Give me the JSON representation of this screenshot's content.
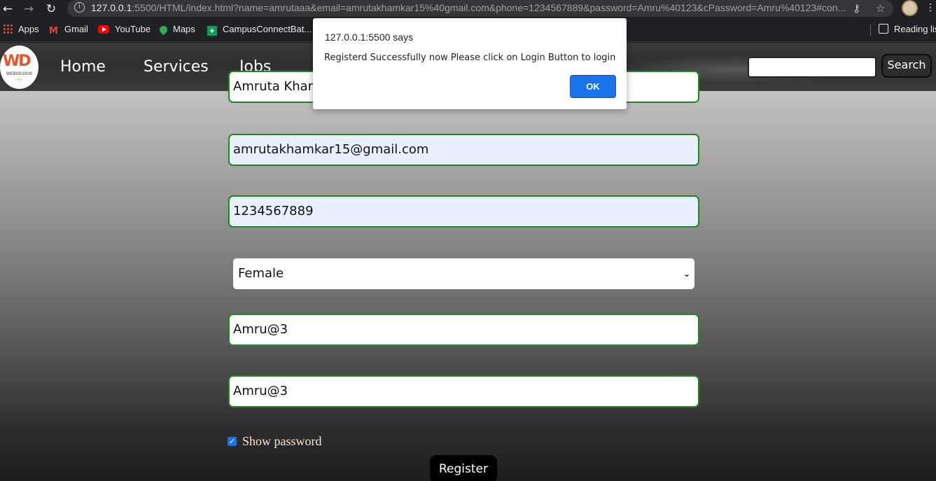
{
  "browser": {
    "url_host": "127.0.0.1",
    "url_rest": ":5500/HTML/index.html?name=amrutaaa&email=amrutakhamkar15%40gmail.com&phone=1234567889&password=Amru%40123&cPassword=Amru%40123#con..."
  },
  "bookmarks": {
    "apps": "Apps",
    "gmail": "Gmail",
    "youtube": "YouTube",
    "maps": "Maps",
    "campus": "CampusConnectBat...",
    "reading_list": "Reading list"
  },
  "site": {
    "logo_text": "WEBDESIGN",
    "logo_sub": "FREE",
    "nav": [
      "Home",
      "Services",
      "Jobs"
    ],
    "search_button": "Search",
    "search_value": ""
  },
  "form": {
    "name_value": "Amruta Khamkar",
    "email_value": "amrutakhamkar15@gmail.com",
    "phone_value": "1234567889",
    "gender_value": "Female",
    "password_value": "Amru@3",
    "confirm_password_value": "Amru@3",
    "show_password_label": "Show password",
    "register_label": "Register"
  },
  "alert": {
    "title": "127.0.0.1:5500 says",
    "message": "Registerd Successfully now Please click on Login Button to login",
    "ok_label": "OK"
  },
  "colors": {
    "field_border": "#1c8a1c",
    "autofill_bg": "#e8f0fe",
    "ok_button": "#1a73e8"
  }
}
